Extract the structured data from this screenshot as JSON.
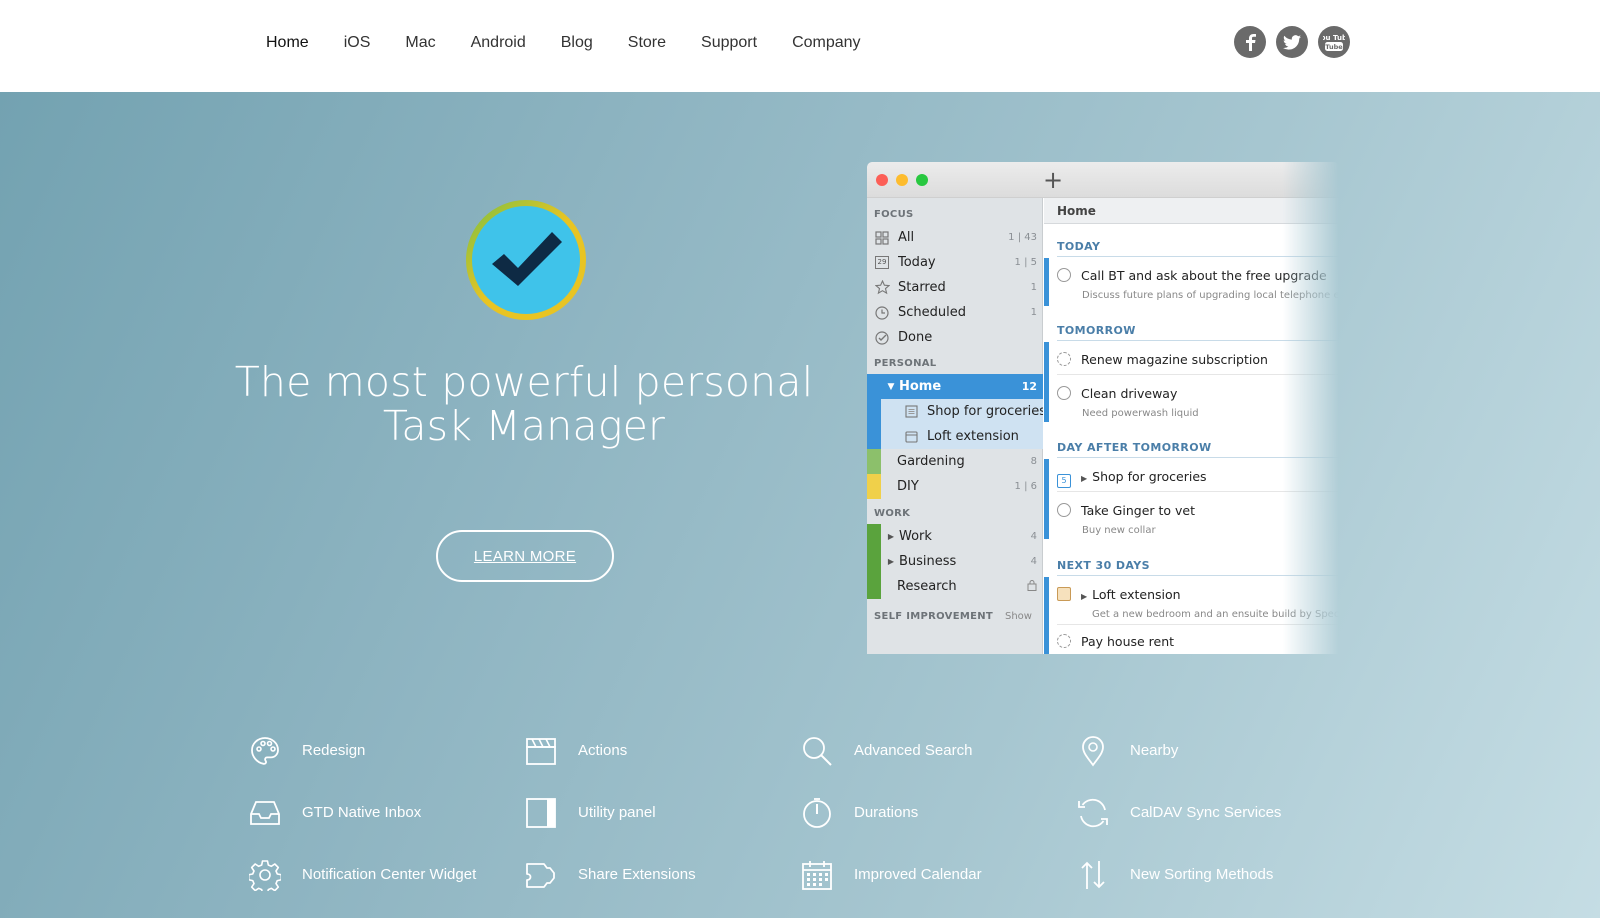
{
  "nav": [
    "Home",
    "iOS",
    "Mac",
    "Android",
    "Blog",
    "Store",
    "Support",
    "Company"
  ],
  "social": [
    "facebook-icon",
    "twitter-icon",
    "youtube-icon"
  ],
  "social_text": {
    "youtube": "You Tube"
  },
  "hero": {
    "headline_line1": "The most powerful personal",
    "headline_line2": "Task Manager",
    "learn_more": "LEARN MORE"
  },
  "colors": {
    "accent": "#3a92d8",
    "logo_ring": "#e8c423",
    "logo_fill": "#3fc3ea"
  },
  "app": {
    "sidebar": {
      "focus_header": "FOCUS",
      "focus": [
        {
          "label": "All",
          "count": "1 | 43",
          "icon": "grid-icon"
        },
        {
          "label": "Today",
          "count": "1 | 5",
          "icon": "calendar-29-icon"
        },
        {
          "label": "Starred",
          "count": "1",
          "icon": "star-icon"
        },
        {
          "label": "Scheduled",
          "count": "1",
          "icon": "clock-icon"
        },
        {
          "label": "Done",
          "count": "",
          "icon": "check-circle-icon"
        }
      ],
      "today_badge": "29",
      "personal_header": "PERSONAL",
      "home": {
        "label": "Home",
        "count": "12"
      },
      "home_children": [
        {
          "label": "Shop for groceries",
          "icon": "list-icon"
        },
        {
          "label": "Loft extension",
          "icon": "box-icon"
        }
      ],
      "personal": [
        {
          "label": "Gardening",
          "count": "8",
          "color": "#8cc06b"
        },
        {
          "label": "DIY",
          "count": "1 | 6",
          "color": "#f0d04a"
        }
      ],
      "work_header": "WORK",
      "work": [
        {
          "label": "Work",
          "count": "4",
          "color": "#5aa33d"
        },
        {
          "label": "Business",
          "count": "4",
          "color": "#5aa33d"
        },
        {
          "label": "Research",
          "count": "",
          "color": "#5aa33d"
        }
      ],
      "self_header": "SELF IMPROVEMENT",
      "self_show": "Show"
    },
    "main": {
      "crumb": "Home",
      "groups": [
        {
          "title": "TODAY",
          "tasks": [
            {
              "title": "Call BT and ask about the free upgrade",
              "note": "Discuss future plans of upgrading local telephone exchange"
            }
          ]
        },
        {
          "title": "TOMORROW",
          "tasks": [
            {
              "title": "Renew magazine subscription",
              "note": ""
            },
            {
              "title": "Clean driveway",
              "note": "Need powerwash liquid"
            }
          ]
        },
        {
          "title": "DAY AFTER TOMORROW",
          "tasks": [
            {
              "title": "Shop for groceries",
              "note": ""
            },
            {
              "title": "Take Ginger to vet",
              "note": "Buy new collar"
            }
          ]
        },
        {
          "title": "NEXT 30 DAYS",
          "tasks": [
            {
              "title": "Loft extension",
              "note": "Get a new bedroom and an ensuite build by Spec"
            },
            {
              "title": "Pay house rent",
              "note": ""
            }
          ]
        }
      ]
    }
  },
  "features": [
    {
      "label": "Redesign",
      "icon": "palette-icon"
    },
    {
      "label": "Actions",
      "icon": "clapperboard-icon"
    },
    {
      "label": "Advanced Search",
      "icon": "search-icon"
    },
    {
      "label": "Nearby",
      "icon": "location-pin-icon"
    },
    {
      "label": "GTD Native Inbox",
      "icon": "inbox-icon"
    },
    {
      "label": "Utility panel",
      "icon": "panel-icon"
    },
    {
      "label": "Durations",
      "icon": "timer-icon"
    },
    {
      "label": "CalDAV Sync Services",
      "icon": "sync-icon"
    },
    {
      "label": "Notification Center Widget",
      "icon": "gear-icon"
    },
    {
      "label": "Share Extensions",
      "icon": "share-extension-icon"
    },
    {
      "label": "Improved Calendar",
      "icon": "calendar-icon"
    },
    {
      "label": "New Sorting Methods",
      "icon": "sort-icon"
    }
  ]
}
